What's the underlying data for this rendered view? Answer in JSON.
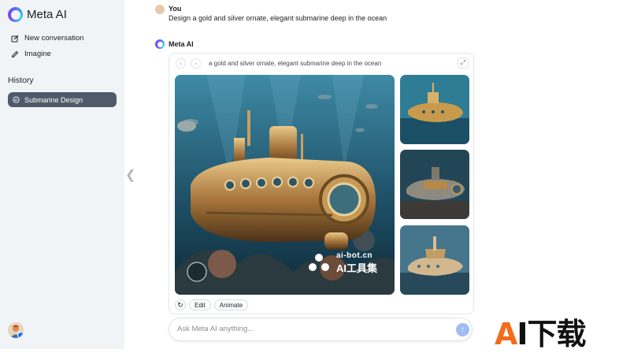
{
  "sidebar": {
    "brand": "Meta AI",
    "nav": [
      {
        "label": "New conversation",
        "icon": "compose-icon"
      },
      {
        "label": "Imagine",
        "icon": "pencil-icon"
      }
    ],
    "history_title": "History",
    "history_items": [
      {
        "label": "Submarine Design",
        "icon": "chat-bubble-icon"
      }
    ]
  },
  "conversation": {
    "user_name": "You",
    "user_prompt": "Design a gold and silver ornate, elegant submarine deep in the ocean",
    "assistant_name": "Meta AI",
    "card_prompt": "a gold and silver ornate, elegant submarine deep in the ocean",
    "actions": {
      "regenerate_icon": "↻",
      "edit": "Edit",
      "animate": "Animate"
    }
  },
  "watermark": {
    "line1": "ai-bot.cn",
    "line2": "AI工具集"
  },
  "input": {
    "placeholder": "Ask Meta AI anything..."
  },
  "corner_logo": {
    "prefix": "A",
    "rest": "I下载"
  },
  "colors": {
    "accent": "#9fbcf5",
    "history_active": "#4f5b6a",
    "sidebar_bg": "#f1f4f7",
    "logo_orange": "#f26c1c"
  }
}
